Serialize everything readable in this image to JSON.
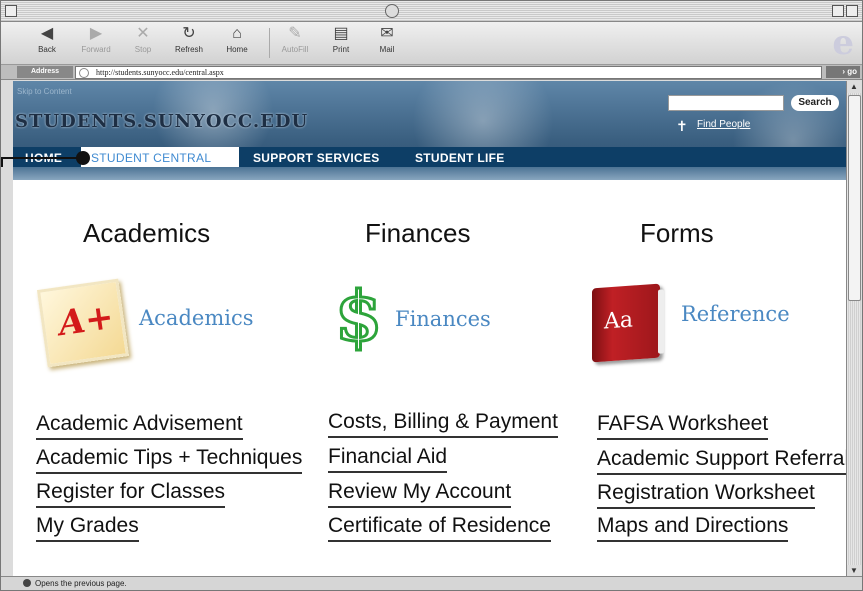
{
  "toolbar": {
    "back": "Back",
    "forward": "Forward",
    "stop": "Stop",
    "refresh": "Refresh",
    "home": "Home",
    "autofill": "AutoFill",
    "print": "Print",
    "mail": "Mail"
  },
  "address": {
    "label": "Address",
    "url": "http://students.sunyocc.edu/central.aspx",
    "go": "go"
  },
  "site": {
    "skip": "Skip to Content",
    "name": "STUDENTS.SUNYOCC.EDU",
    "search_button": "Search",
    "find_people": "Find People"
  },
  "nav": {
    "home": "HOME",
    "student_central": "STUDENT CENTRAL",
    "support_services": "SUPPORT SERVICES",
    "student_life": "STUDENT LIFE"
  },
  "columns": {
    "academics": {
      "heading": "Academics",
      "feature": "Academics",
      "links": [
        "Academic Advisement",
        "Academic Tips + Techniques",
        "Register for Classes",
        "My Grades"
      ]
    },
    "finances": {
      "heading": "Finances",
      "feature": "Finances",
      "links": [
        "Costs, Billing & Payment",
        "Financial Aid",
        "Review My Account",
        "Certificate of Residence"
      ]
    },
    "forms": {
      "heading": "Forms",
      "feature": "Reference",
      "links": [
        "FAFSA Worksheet",
        "Academic Support Referral",
        "Registration Worksheet",
        "Maps and Directions"
      ]
    }
  },
  "icons": {
    "grade": "A+",
    "dollar": "$",
    "book": "Aa"
  },
  "status": {
    "text": "Opens the previous page."
  },
  "colors": {
    "nav_bg": "#0d3e66",
    "link_accent": "#4a88c2",
    "active_tab_text": "#3f8ad1"
  }
}
